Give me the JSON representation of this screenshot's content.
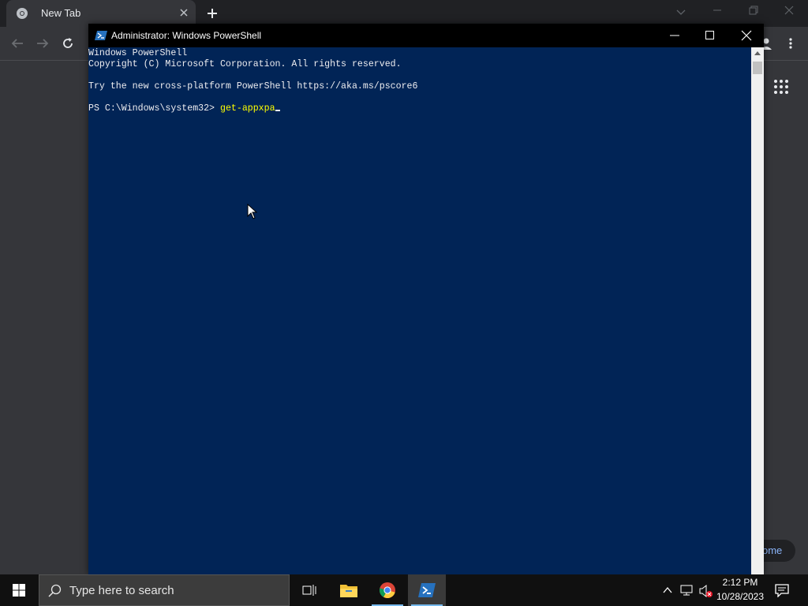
{
  "browser": {
    "tab_title": "New Tab",
    "customize_label": "ome"
  },
  "powershell": {
    "window_title": "Administrator: Windows PowerShell",
    "lines": [
      "Windows PowerShell",
      "Copyright (C) Microsoft Corporation. All rights reserved.",
      "",
      "Try the new cross-platform PowerShell https://aka.ms/pscore6",
      ""
    ],
    "prompt": "PS C:\\Windows\\system32> ",
    "command_input": "get-appxpa",
    "colors": {
      "console_bg": "#012456",
      "console_text": "#eeedf0",
      "command_text": "#ffff00"
    }
  },
  "taskbar": {
    "search_placeholder": "Type here to search",
    "time": "2:12 PM",
    "date": "10/28/2023",
    "accent": "#76b9ed"
  },
  "icons": [
    "chrome-icon",
    "close-icon",
    "plus-icon",
    "back-arrow-icon",
    "forward-arrow-icon",
    "reload-icon",
    "apps-grid-icon",
    "more-vert-icon",
    "powershell-icon",
    "minimize-icon",
    "maximize-icon",
    "windows-start-icon",
    "search-icon",
    "task-view-icon",
    "file-explorer-icon",
    "chevron-up-icon",
    "network-icon",
    "volume-muted-icon",
    "notification-icon",
    "mouse-cursor-icon"
  ]
}
